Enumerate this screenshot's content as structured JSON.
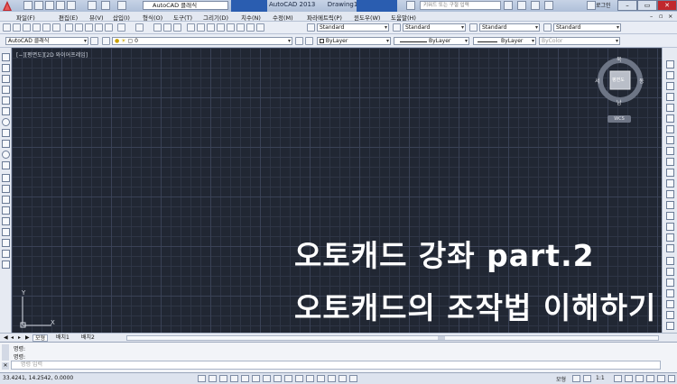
{
  "window": {
    "app_title": "AutoCAD 2013",
    "document": "Drawing1.dwg",
    "workspace": "AutoCAD 클래식",
    "search_placeholder": "키워드 또는 구절 입력",
    "login": "로그인"
  },
  "menu": [
    "파일(F)",
    "편집(E)",
    "뷰(V)",
    "삽입(I)",
    "형식(O)",
    "도구(T)",
    "그리기(D)",
    "치수(N)",
    "수정(M)",
    "파라메트릭(P)",
    "윈도우(W)",
    "도움말(H)"
  ],
  "styles_toolbar": {
    "text_style": "Standard",
    "dim_style": "Standard",
    "table_style": "Standard",
    "mleader_style": "Standard"
  },
  "layers_toolbar": {
    "workspace": "AutoCAD 클래식",
    "layer": "0"
  },
  "properties_toolbar": {
    "color": "ByLayer",
    "linetype": "ByLayer",
    "lineweight": "ByLayer",
    "plot_style": "ByColor"
  },
  "canvas": {
    "viewport_label": "[−][평면도][2D 와이어프레임]",
    "overlay_line1": "오토캐드 강좌 part.2",
    "overlay_line2": "오토캐드의 조작법 이해하기",
    "ucs_x": "X",
    "ucs_y": "Y"
  },
  "viewcube": {
    "north": "북",
    "south": "남",
    "east": "동",
    "west": "서",
    "face": "평면도",
    "wcs": "WCS"
  },
  "layout_tabs": [
    "모형",
    "배치1",
    "배치2"
  ],
  "command": {
    "history": [
      "명령:",
      "명령:"
    ],
    "input_placeholder": "명령 입력"
  },
  "status": {
    "coordinates": "33.4241, 14.2542, 0.0000",
    "model": "모형",
    "scale": "1:1"
  },
  "colors": {
    "canvas_bg": "#212733",
    "chrome": "#e6eaf2",
    "accent": "#c0282d"
  }
}
